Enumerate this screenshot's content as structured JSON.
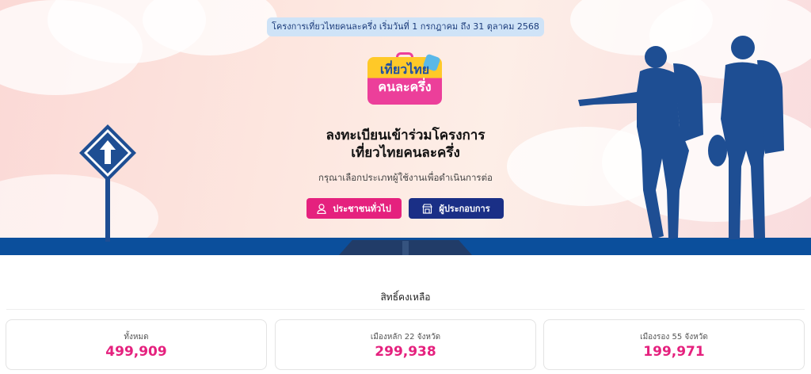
{
  "notice": "โครงการเที่ยวไทยคนละครึ่ง เริ่มวันที่ 1 กรกฎาคม ถึง 31 ตุลาคม 2568",
  "logo": {
    "line1": "เที่ยวไทย",
    "line2": "คนละครึ่ง"
  },
  "title": {
    "line1": "ลงทะเบียนเข้าร่วมโครงการ",
    "line2": "เที่ยวไทยคนละครึ่ง"
  },
  "subtitle": "กรุณาเลือกประเภทผู้ใช้งานเพื่อดำเนินการต่อ",
  "buttons": {
    "public": {
      "label": "ประชาชนทั่วไป",
      "icon": "user-icon",
      "color": "#e5217e"
    },
    "merchant": {
      "label": "ผู้ประกอบการ",
      "icon": "shop-icon",
      "color": "#1a2f86"
    }
  },
  "remaining": {
    "label": "สิทธิ์คงเหลือ",
    "cards": [
      {
        "label": "ทั้งหมด",
        "value": "499,909"
      },
      {
        "label": "เมืองหลัก 22 จังหวัด",
        "value": "299,938"
      },
      {
        "label": "เมืองรอง 55 จังหวัด",
        "value": "199,971"
      }
    ]
  },
  "colors": {
    "accent": "#e5217e",
    "navy": "#1a2f86",
    "road": "#0b4f9c"
  }
}
